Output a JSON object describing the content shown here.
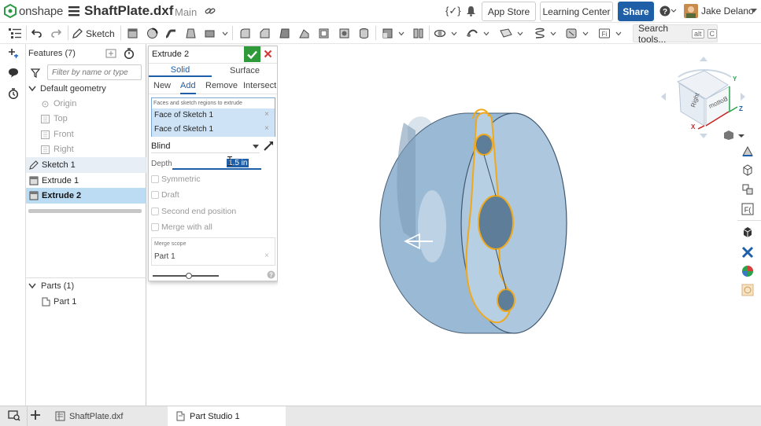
{
  "header": {
    "logo_text": "onshape",
    "doc_title": "ShaftPlate.dxf",
    "branch": "Main",
    "app_store": "App Store",
    "learning_center": "Learning Center",
    "share": "Share",
    "user_name": "Jake Delano"
  },
  "toolbar": {
    "sketch_label": "Sketch",
    "search_label": "Search tools...",
    "search_shortcut_alt": "alt",
    "search_shortcut_key": "C"
  },
  "features": {
    "title": "Features (7)",
    "filter_placeholder": "Filter by name or type",
    "items": [
      {
        "label": "Default geometry"
      },
      {
        "label": "Origin"
      },
      {
        "label": "Top"
      },
      {
        "label": "Front"
      },
      {
        "label": "Right"
      },
      {
        "label": "Sketch 1"
      },
      {
        "label": "Extrude 1"
      },
      {
        "label": "Extrude 2"
      }
    ],
    "parts_header": "Parts (1)",
    "parts": [
      {
        "label": "Part 1"
      }
    ]
  },
  "dialog": {
    "title": "Extrude 2",
    "tabs": [
      "Solid",
      "Surface"
    ],
    "ops": [
      "New",
      "Add",
      "Remove",
      "Intersect"
    ],
    "regions_label": "Faces and sketch regions to extrude",
    "regions": [
      "Face of Sketch 1",
      "Face of Sketch 1"
    ],
    "end_type": "Blind",
    "depth_label": "Depth",
    "depth_value": "1.5 in",
    "options": [
      "Symmetric",
      "Draft",
      "Second end position",
      "Merge with all"
    ],
    "merge_scope_label": "Merge scope",
    "merge_scope_value": "Part 1",
    "preview_slider": 0.55
  },
  "viewcube": {
    "right_label": "Right",
    "bottom_label": "Bottom",
    "x": "X",
    "y": "Y",
    "z": "Z"
  },
  "tabs": [
    {
      "label": "ShaftPlate.dxf"
    },
    {
      "label": "Part Studio 1"
    }
  ],
  "colors": {
    "accent": "#1f5fa8",
    "selection": "#cfe3f6",
    "edge_highlight": "#f0a81c",
    "part": "#9ab9d4",
    "confirm": "#2f9a3a",
    "cancel": "#d43a3a"
  }
}
